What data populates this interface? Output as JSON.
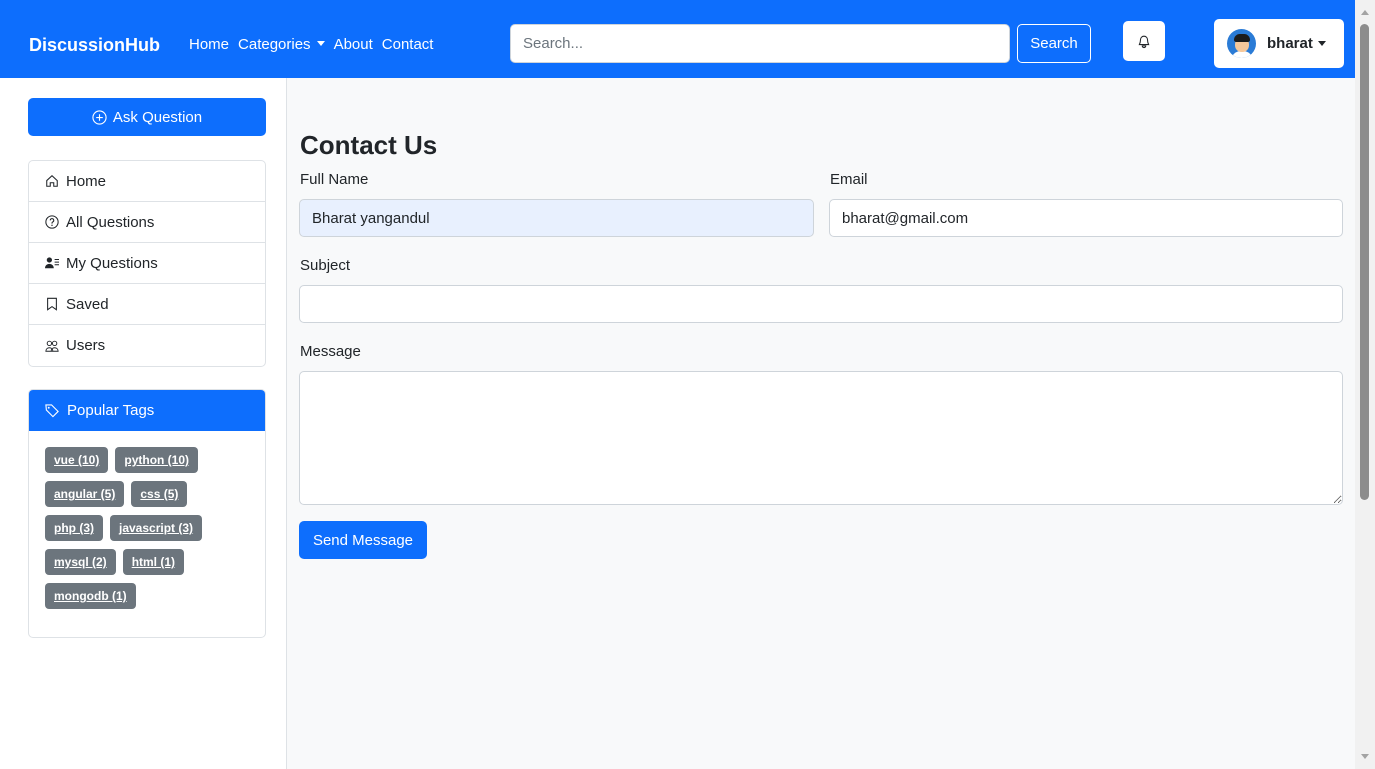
{
  "navbar": {
    "brand": "DiscussionHub",
    "links": [
      "Home",
      "Categories",
      "About",
      "Contact"
    ],
    "search_placeholder": "Search...",
    "search_button": "Search",
    "username": "bharat"
  },
  "sidebar": {
    "ask_button": "Ask Question",
    "menu": [
      "Home",
      "All Questions",
      "My Questions",
      "Saved",
      "Users"
    ],
    "tags_title": "Popular Tags",
    "tags": [
      [
        "vue (10)",
        "python (10)"
      ],
      [
        "angular (5)",
        "css (5)"
      ],
      [
        "php (3)",
        "javascript (3)"
      ],
      [
        "mysql (2)",
        "html (1)"
      ],
      [
        "mongodb (1)"
      ]
    ]
  },
  "form": {
    "title": "Contact Us",
    "full_name_label": "Full Name",
    "full_name_value": "Bharat yangandul",
    "email_label": "Email",
    "email_value": "bharat@gmail.com",
    "subject_label": "Subject",
    "subject_value": "",
    "message_label": "Message",
    "message_value": "",
    "send_button": "Send Message"
  },
  "colors": {
    "primary": "#0d6efd",
    "tag": "#6c757d",
    "autofill": "#e8f0fe"
  }
}
